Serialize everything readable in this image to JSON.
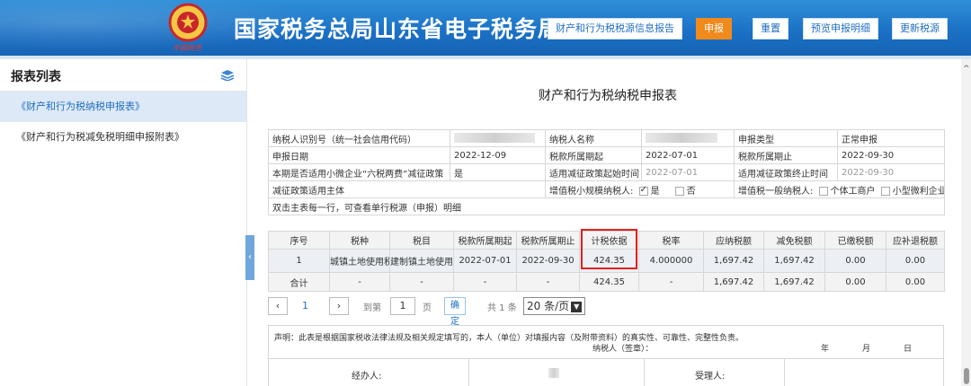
{
  "header": {
    "title": "国家税务总局山东省电子税务局",
    "emblem_caption": "中国税务",
    "buttons": [
      "财产和行为税税源信息报告",
      "申报",
      "重置",
      "预览申报明细",
      "更新税源"
    ]
  },
  "sidebar": {
    "title": "报表列表",
    "items": [
      {
        "label": "《财产和行为税纳税申报表》",
        "active": true
      },
      {
        "label": "《财产和行为税减免税明细申报附表》",
        "active": false
      }
    ]
  },
  "report": {
    "title": "财产和行为税纳税申报表",
    "info": {
      "taxpayer_id_label": "纳税人识别号（统一社会信用代码）",
      "taxpayer_name_label": "纳税人名称",
      "declare_type_label": "申报类型",
      "declare_type_value": "正常申报",
      "declare_date_label": "申报日期",
      "declare_date_value": "2022-12-09",
      "period_start_label": "税款所属期起",
      "period_start_value": "2022-07-01",
      "period_end_label": "税款所属期止",
      "period_end_value": "2022-09-30",
      "small_micro_label": "本期是否适用小微企业“六税两费”减征政策",
      "small_micro_value": "是",
      "policy_start_label": "适用减征政策起始时间",
      "policy_start_value": "2022-07-01",
      "policy_end_label": "适用减征政策终止时间",
      "policy_end_value": "2022-09-30",
      "policy_subject_label": "减征政策适用主体",
      "vat_small_label": "增值税小规模纳税人:",
      "vat_yes": "是",
      "vat_no": "否",
      "vat_general_label": "增值税一般纳税人:",
      "individual_label": "个体工商户",
      "micro_label": "小型微利企业",
      "hint": "双击主表每一行，可查看单行税源（申报）明细"
    },
    "columns": [
      "序号",
      "税种",
      "税目",
      "税款所属期起",
      "税款所属期止",
      "计税依据",
      "税率",
      "应纳税额",
      "减免税额",
      "已缴税额",
      "应补退税额"
    ],
    "rows": [
      [
        "1",
        "城镇土地使用税",
        "建制镇土地使用",
        "2022-07-01",
        "2022-09-30",
        "424.35",
        "4.000000",
        "1,697.42",
        "1,697.42",
        "0.00",
        "0.00"
      ]
    ],
    "total": [
      "合计",
      "-",
      "-",
      "-",
      "-",
      "424.35",
      "-",
      "1,697.42",
      "1,697.42",
      "0.00",
      "0.00"
    ]
  },
  "pager": {
    "current": "1",
    "goto_label": "到第",
    "goto_value": "1",
    "page_unit": "页",
    "confirm": "确定",
    "total_text": "共 1 条",
    "page_size": "20 条/页"
  },
  "declaration": {
    "statement": "声明：此表是根据国家税收法律法规及相关规定填写的，本人（单位）对填报内容（及附带资料）的真实性、可靠性、完整性负责。",
    "signer": "纳税人（签章）：",
    "year": "年",
    "month": "月",
    "day": "日",
    "handler": "经办人:",
    "acceptor": "受理人:"
  },
  "colors": {
    "header": "#1a6fc4",
    "accent_orange": "#f08a1c",
    "highlight": "#e02020",
    "active_bg": "#dde9f7"
  }
}
